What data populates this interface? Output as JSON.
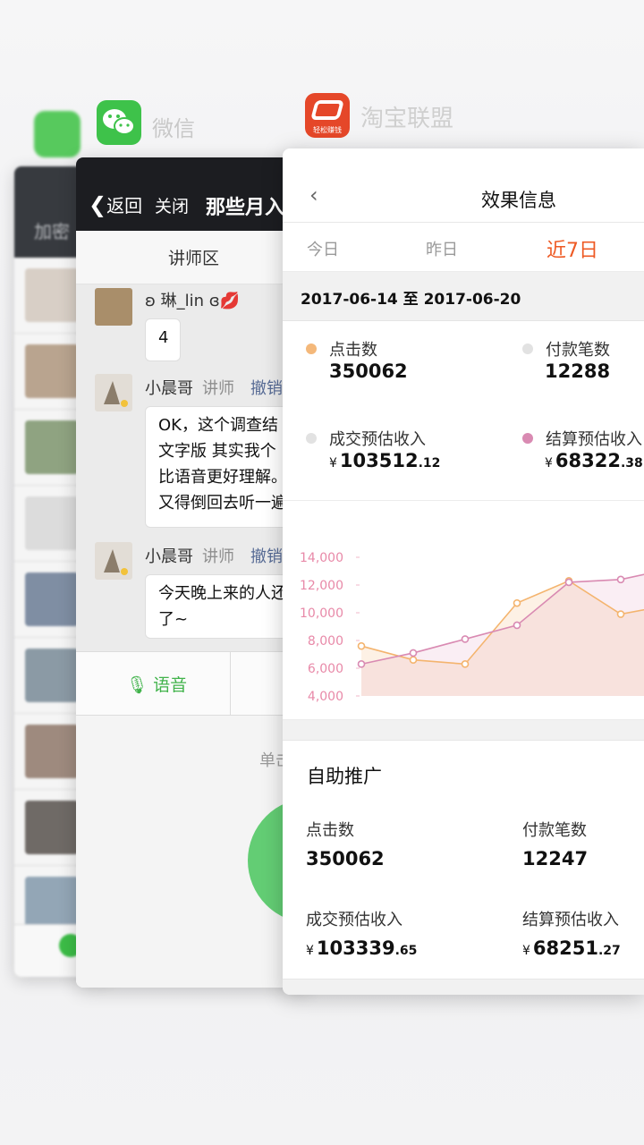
{
  "switcher": {
    "wechat_app_name": "微信",
    "taobao_app_name": "淘宝联盟",
    "taobao_icon_caption": "轻松赚钱"
  },
  "back_app": {
    "header_label": "加密"
  },
  "wechat": {
    "back_label": "返回",
    "close_label": "关闭",
    "title": "那些月入",
    "tab_label": "讲师区",
    "messages": [
      {
        "user": "ʚ 琳_lin ɞ💋",
        "role": "",
        "recall": "",
        "text": [
          "4"
        ]
      },
      {
        "user": "小晨哥",
        "role": "讲师",
        "recall": "撤销",
        "text": [
          "OK，这个调查结",
          "文字版 其实我个",
          "比语音更好理解。",
          "又得倒回去听一遍"
        ]
      },
      {
        "user": "小晨哥",
        "role": "讲师",
        "recall": "撤销",
        "text": [
          "今天晚上来的人还",
          "了~"
        ]
      }
    ],
    "voice_label": "语音",
    "press_hint": "单击"
  },
  "taobao": {
    "title": "效果信息",
    "tabs": [
      "今日",
      "昨日",
      "近7日"
    ],
    "active_tab": 2,
    "date_range": "2017-06-14 至 2017-06-20",
    "stats": [
      {
        "label": "点击数",
        "value": "350062",
        "dot": "#f4b87a"
      },
      {
        "label": "付款笔数",
        "value": "12288",
        "dot": "#e2e2e2"
      },
      {
        "label": "成交预估收入",
        "yen": "¥",
        "int": "103512",
        "dec": ".12",
        "dot": "#e2e2e2"
      },
      {
        "label": "结算预估收入",
        "yen": "¥",
        "int": "68322",
        "dec": ".38",
        "dot": "#d98ab2"
      }
    ],
    "promo": {
      "title": "自助推广",
      "click_label": "点击数",
      "click_value": "350062",
      "pay_label": "付款笔数",
      "pay_value": "12247",
      "deal_label": "成交预估收入",
      "deal_yen": "¥",
      "deal_int": "103339",
      "deal_dec": ".65",
      "settle_label": "结算预估收入",
      "settle_yen": "¥",
      "settle_int": "68251",
      "settle_dec": ".27"
    }
  },
  "chart_data": {
    "type": "line",
    "title": "",
    "xlabel": "",
    "ylabel": "",
    "ylim": [
      4000,
      14000
    ],
    "yticks": [
      "14,000",
      "12,000",
      "10,000",
      "8,000",
      "6,000",
      "4,000"
    ],
    "grid": false,
    "series": [
      {
        "color": "#f4b46e",
        "values": [
          7600,
          6600,
          6300,
          10700,
          12300,
          9900,
          10600
        ]
      },
      {
        "color": "#d98ab2",
        "values": [
          6300,
          7100,
          8100,
          9100,
          12200,
          12400,
          13200
        ]
      }
    ]
  },
  "colors": {
    "accent_orange": "#ee5a24",
    "wechat_green": "#41b34b",
    "recall_blue": "#576b95"
  }
}
